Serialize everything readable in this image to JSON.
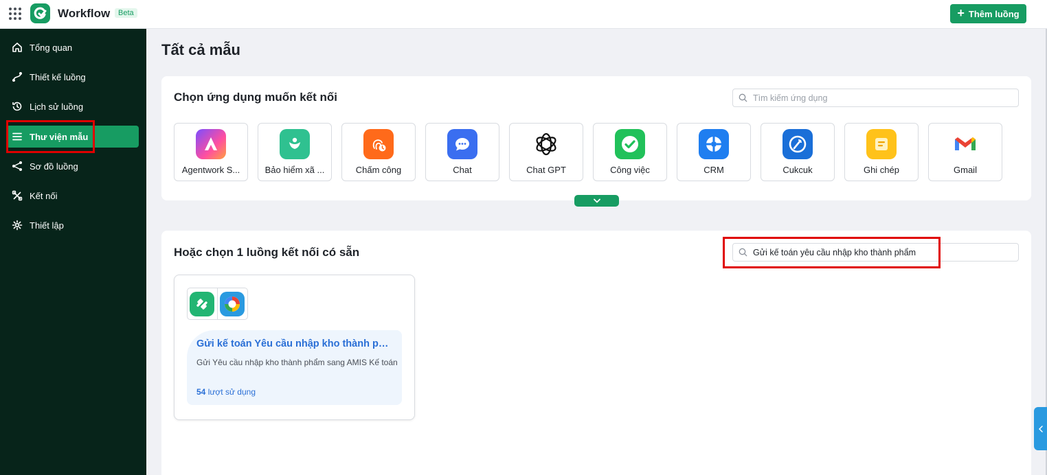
{
  "app": {
    "title": "Workflow",
    "badge": "Beta",
    "add_flow_label": "Thêm luồng"
  },
  "sidebar": {
    "items": [
      {
        "label": "Tổng quan",
        "icon": "home-icon"
      },
      {
        "label": "Thiết kế luồng",
        "icon": "flow-design-icon"
      },
      {
        "label": "Lịch sử luồng",
        "icon": "history-icon"
      },
      {
        "label": "Thư viện mẫu",
        "icon": "menu-list-icon",
        "active": true
      },
      {
        "label": "Sơ đồ luồng",
        "icon": "share-nodes-icon"
      },
      {
        "label": "Kết nối",
        "icon": "connect-icon"
      },
      {
        "label": "Thiết lập",
        "icon": "gear-icon"
      }
    ]
  },
  "page": {
    "title": "Tất cả mẫu"
  },
  "apps_section": {
    "title": "Chọn ứng dụng muốn kết nối",
    "search_placeholder": "Tìm kiếm ứng dụng",
    "apps": [
      {
        "label": "Agentwork S...",
        "icon": "agentwork-icon"
      },
      {
        "label": "Bảo hiểm xã ...",
        "icon": "insurance-icon"
      },
      {
        "label": "Chấm công",
        "icon": "timekeeping-icon"
      },
      {
        "label": "Chat",
        "icon": "chat-icon"
      },
      {
        "label": "Chat GPT",
        "icon": "chatgpt-icon"
      },
      {
        "label": "Công việc",
        "icon": "task-icon"
      },
      {
        "label": "CRM",
        "icon": "crm-icon"
      },
      {
        "label": "Cukcuk",
        "icon": "cukcuk-icon"
      },
      {
        "label": "Ghi chép",
        "icon": "note-icon"
      },
      {
        "label": "Gmail",
        "icon": "gmail-icon"
      }
    ]
  },
  "flows_section": {
    "title": "Hoặc chọn 1 luồng kết nối có sẵn",
    "search_value": "Gửi kế toán yêu cầu nhập kho thành phẩm",
    "flows": [
      {
        "title": "Gửi kế toán Yêu cầu nhập kho thành phẩm",
        "description": "Gửi Yêu cầu nhập kho thành phẩm sang AMIS Kế toán",
        "usage_count": "54",
        "usage_label": "lượt sử dụng"
      }
    ]
  },
  "colors": {
    "brand_green": "#179c62",
    "sidebar_bg": "#07241a",
    "link_blue": "#2a6fd6",
    "highlight_red": "#e00000"
  }
}
